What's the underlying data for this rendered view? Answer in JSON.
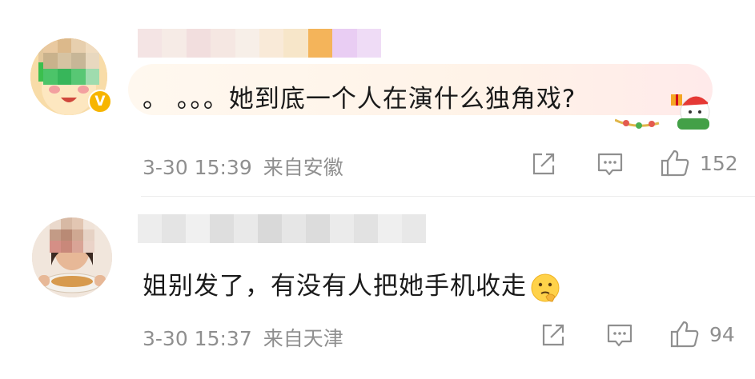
{
  "comments": [
    {
      "text": "。 。。。她到底一个人在演什么独角戏?",
      "time": "3-30 15:39",
      "location": "来自安徽",
      "likes": "152",
      "verified": true,
      "verified_badge": "V",
      "icons": [
        "share-icon",
        "comment-icon",
        "like-icon"
      ],
      "decoration": "christmas-pendant"
    },
    {
      "text": "姐别发了，有没有人把她手机收走",
      "time": "3-30 15:37",
      "location": "来自天津",
      "likes": "94",
      "emoji": "thinking-face-emoji",
      "icons": [
        "share-icon",
        "comment-icon",
        "like-icon"
      ]
    }
  ]
}
